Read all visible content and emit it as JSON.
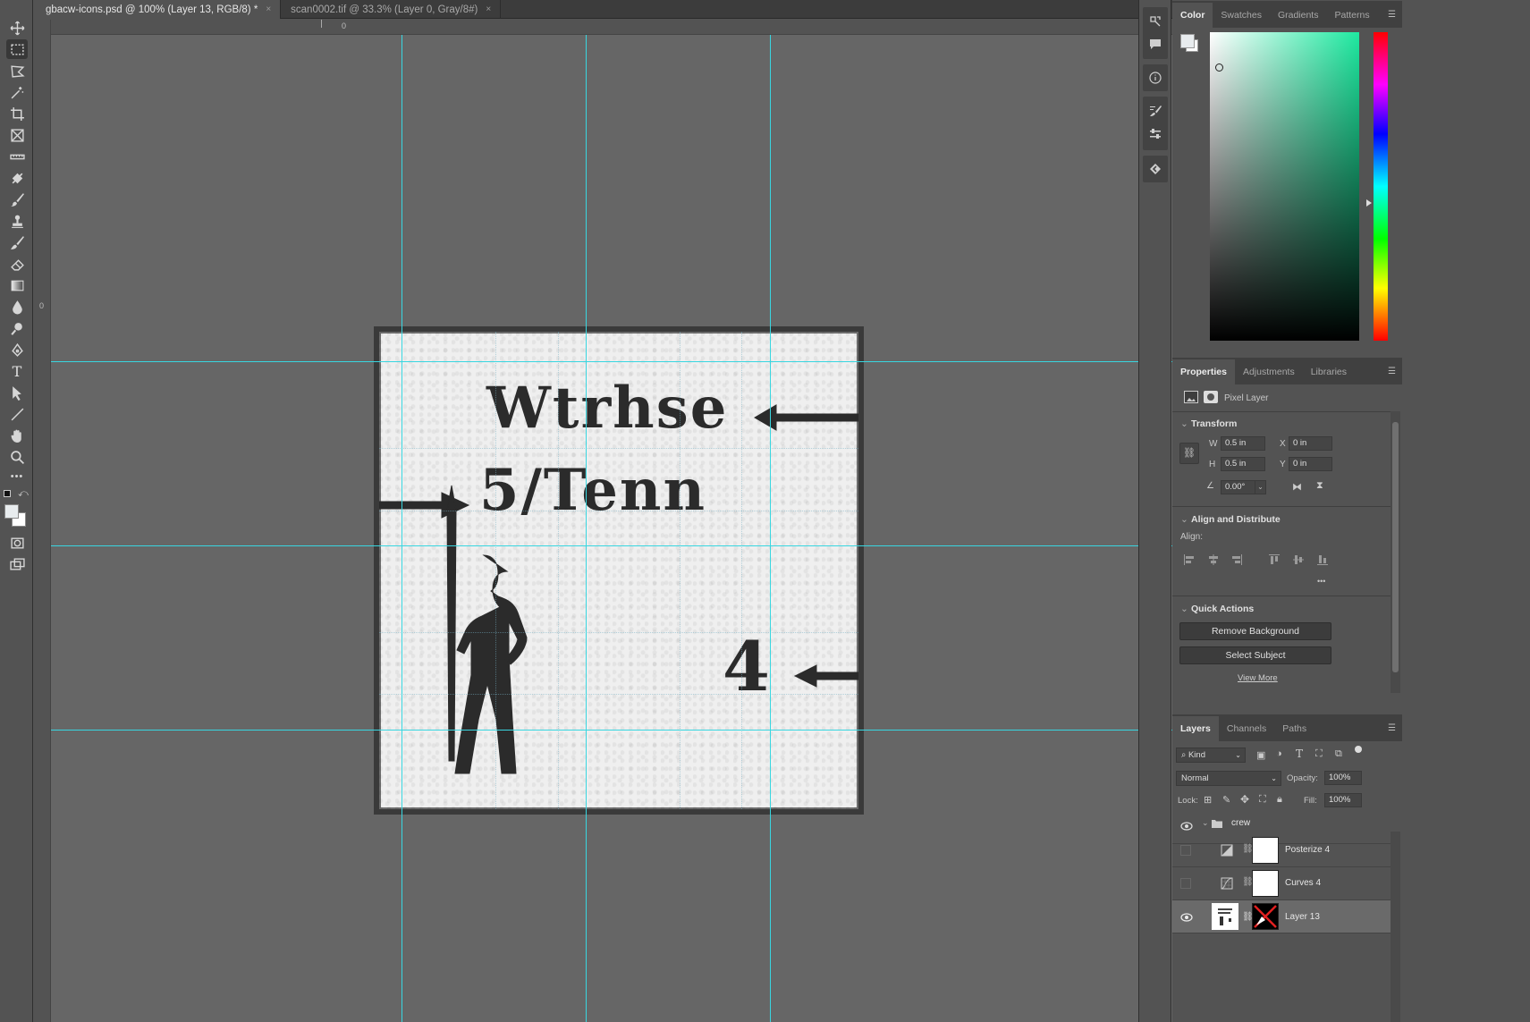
{
  "tabs": [
    {
      "label": "gbacw-icons.psd @ 100% (Layer 13, RGB/8) *",
      "active": true,
      "close": "×"
    },
    {
      "label": "scan0002.tif @ 33.3% (Layer 0, Gray/8#)",
      "active": false,
      "close": "×"
    }
  ],
  "toolbar": {
    "icons": [
      "move-icon",
      "marquee-icon",
      "lasso-icon",
      "magic-wand-icon",
      "crop-icon",
      "frame-icon",
      "ruler-icon",
      "healing-brush-icon",
      "brush-icon",
      "stamp-icon",
      "history-brush-icon",
      "eraser-icon",
      "gradient-icon",
      "blur-icon",
      "dodge-icon",
      "pen-icon",
      "type-icon",
      "path-selection-icon",
      "line-icon",
      "hand-icon",
      "zoom-icon",
      "more-tools-icon"
    ],
    "type_glyph": "T",
    "more_glyph": "•••"
  },
  "rulers": {
    "top_zero": "0",
    "left_zero": "0"
  },
  "document": {
    "line1": "Wtrhse",
    "line2": "5/Tenn",
    "number": "4"
  },
  "color_panel": {
    "tabs": [
      "Color",
      "Swatches",
      "Gradients",
      "Patterns"
    ],
    "active_tab": "Color",
    "foreground": "#e8ecee",
    "hue_color": "#1ee9a0"
  },
  "properties_panel": {
    "tabs": [
      "Properties",
      "Adjustments",
      "Libraries"
    ],
    "active_tab": "Properties",
    "layer_kind": "Pixel Layer",
    "transform_title": "Transform",
    "w_label": "W",
    "w_value": "0.5 in",
    "h_label": "H",
    "h_value": "0.5 in",
    "x_label": "X",
    "x_value": "0 in",
    "y_label": "Y",
    "y_value": "0 in",
    "angle_value": "0.00°",
    "align_title": "Align and Distribute",
    "align_label": "Align:",
    "more": "•••",
    "quick_actions_title": "Quick Actions",
    "remove_bg": "Remove Background",
    "select_subject": "Select Subject",
    "view_more": "View More"
  },
  "layers_panel": {
    "tabs": [
      "Layers",
      "Channels",
      "Paths"
    ],
    "active_tab": "Layers",
    "filter": "Kind",
    "blend_mode": "Normal",
    "opacity_label": "Opacity:",
    "opacity_value": "100%",
    "lock_label": "Lock:",
    "fill_label": "Fill:",
    "fill_value": "100%",
    "layers": [
      {
        "name": "crew",
        "type": "group",
        "visible": true
      },
      {
        "name": "Posterize 4",
        "type": "adjustment",
        "visible": false
      },
      {
        "name": "Curves 4",
        "type": "adjustment",
        "visible": false
      },
      {
        "name": "Layer 13",
        "type": "pixel",
        "visible": true,
        "selected": true
      }
    ]
  },
  "colors": {
    "guide": "#38d6e0",
    "accent": "#1ee9a0"
  }
}
